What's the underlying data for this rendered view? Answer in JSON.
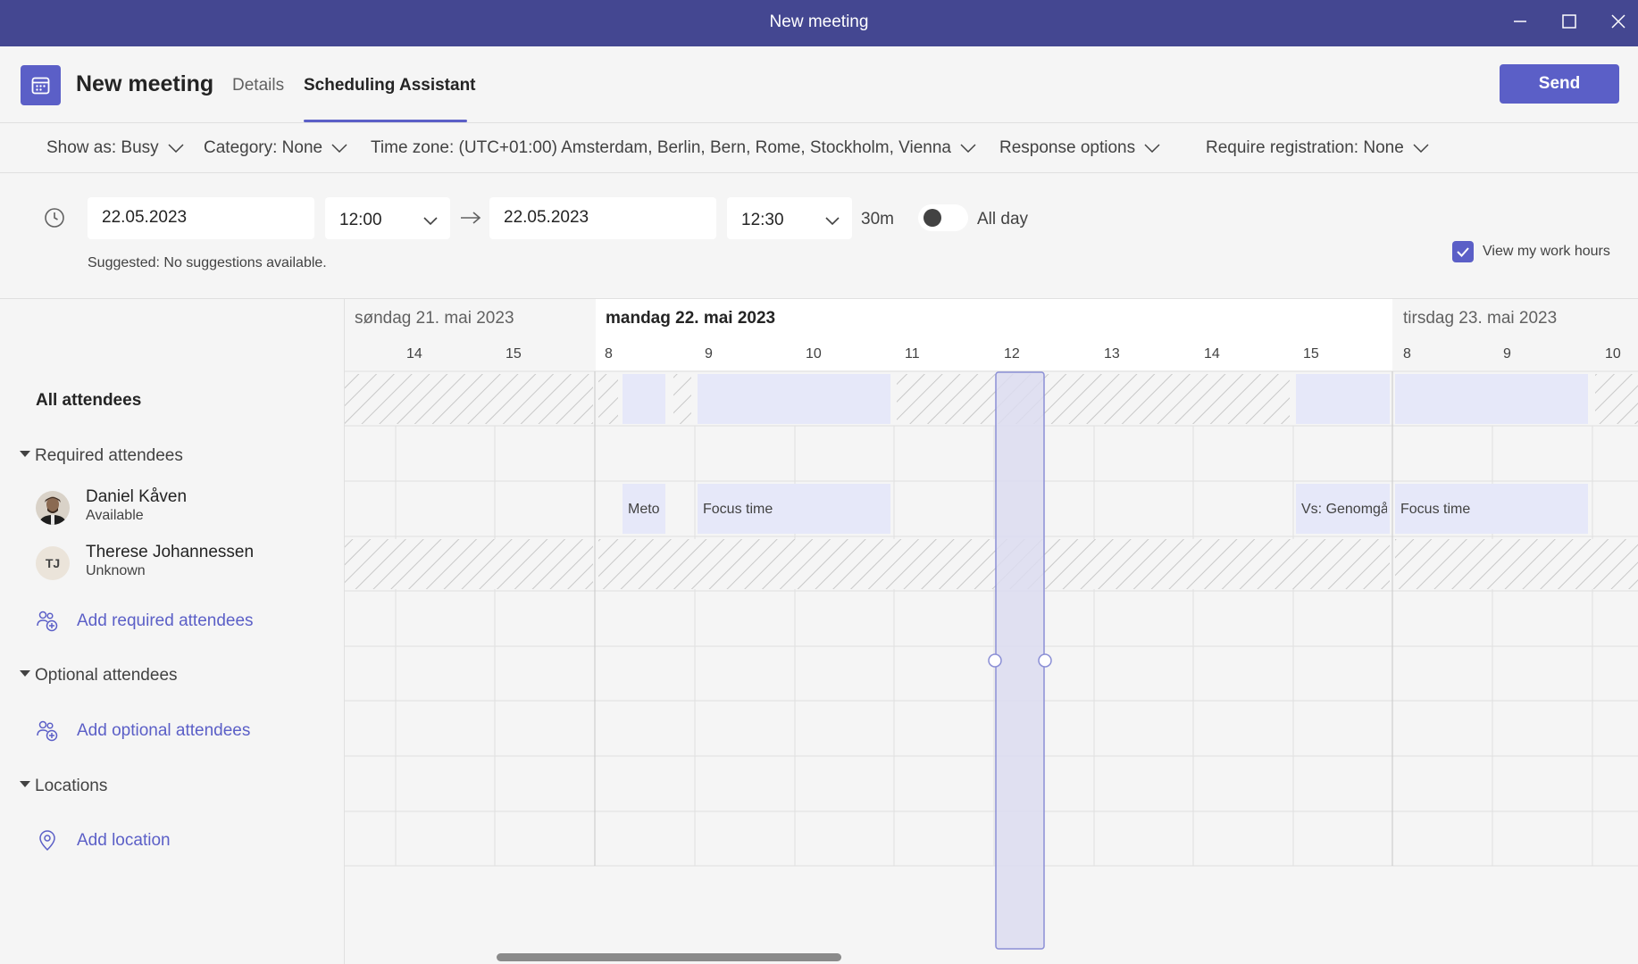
{
  "window": {
    "title": "New meeting"
  },
  "header": {
    "title": "New meeting",
    "tabs": [
      {
        "label": "Details",
        "active": false
      },
      {
        "label": "Scheduling Assistant",
        "active": true
      }
    ],
    "send_label": "Send"
  },
  "options": {
    "show_as": "Show as: Busy",
    "category": "Category: None",
    "time_zone": "Time zone: (UTC+01:00) Amsterdam, Berlin, Bern, Rome, Stockholm, Vienna",
    "response_options": "Response options",
    "registration": "Require registration: None"
  },
  "datetime": {
    "start_date": "22.05.2023",
    "start_time": "12:00",
    "end_date": "22.05.2023",
    "end_time": "12:30",
    "duration": "30m",
    "all_day_label": "All day",
    "all_day": false,
    "suggested": "Suggested: No suggestions available.",
    "view_work_hours_label": "View my work hours",
    "view_work_hours": true
  },
  "attendees": {
    "all_label": "All attendees",
    "required_label": "Required attendees",
    "required": [
      {
        "name": "Daniel Kåven",
        "status": "Available"
      },
      {
        "name": "Therese Johannessen",
        "status": "Unknown",
        "initials": "TJ"
      }
    ],
    "add_required": "Add required attendees",
    "optional_label": "Optional attendees",
    "add_optional": "Add optional attendees",
    "locations_label": "Locations",
    "add_location": "Add location"
  },
  "timeline": {
    "days": [
      "søndag 21. mai 2023",
      "mandag 22. mai 2023",
      "tirsdag 23. mai 2023"
    ],
    "hours_sun": [
      "14",
      "15"
    ],
    "hours_mon": [
      "8",
      "9",
      "10",
      "11",
      "12",
      "13",
      "14",
      "15"
    ],
    "hours_tue": [
      "8",
      "9",
      "10"
    ],
    "events": [
      {
        "title": "Meto"
      },
      {
        "title": "Focus time"
      },
      {
        "title": "Vs: Genomgå"
      },
      {
        "title": "Focus time"
      }
    ]
  },
  "colors": {
    "accent": "#5b5fc7",
    "titlebar": "#444791",
    "busy_block": "#e6e8f9",
    "selection": "#dcdcf0"
  },
  "icons": {
    "calendar": "calendar-icon",
    "clock": "clock-icon",
    "arrow": "arrow-right-icon",
    "chevron": "chevron-down-icon",
    "add_person": "add-person-icon",
    "location": "location-pin-icon",
    "minimize": "minimize-icon",
    "maximize": "maximize-icon",
    "close": "close-icon"
  }
}
